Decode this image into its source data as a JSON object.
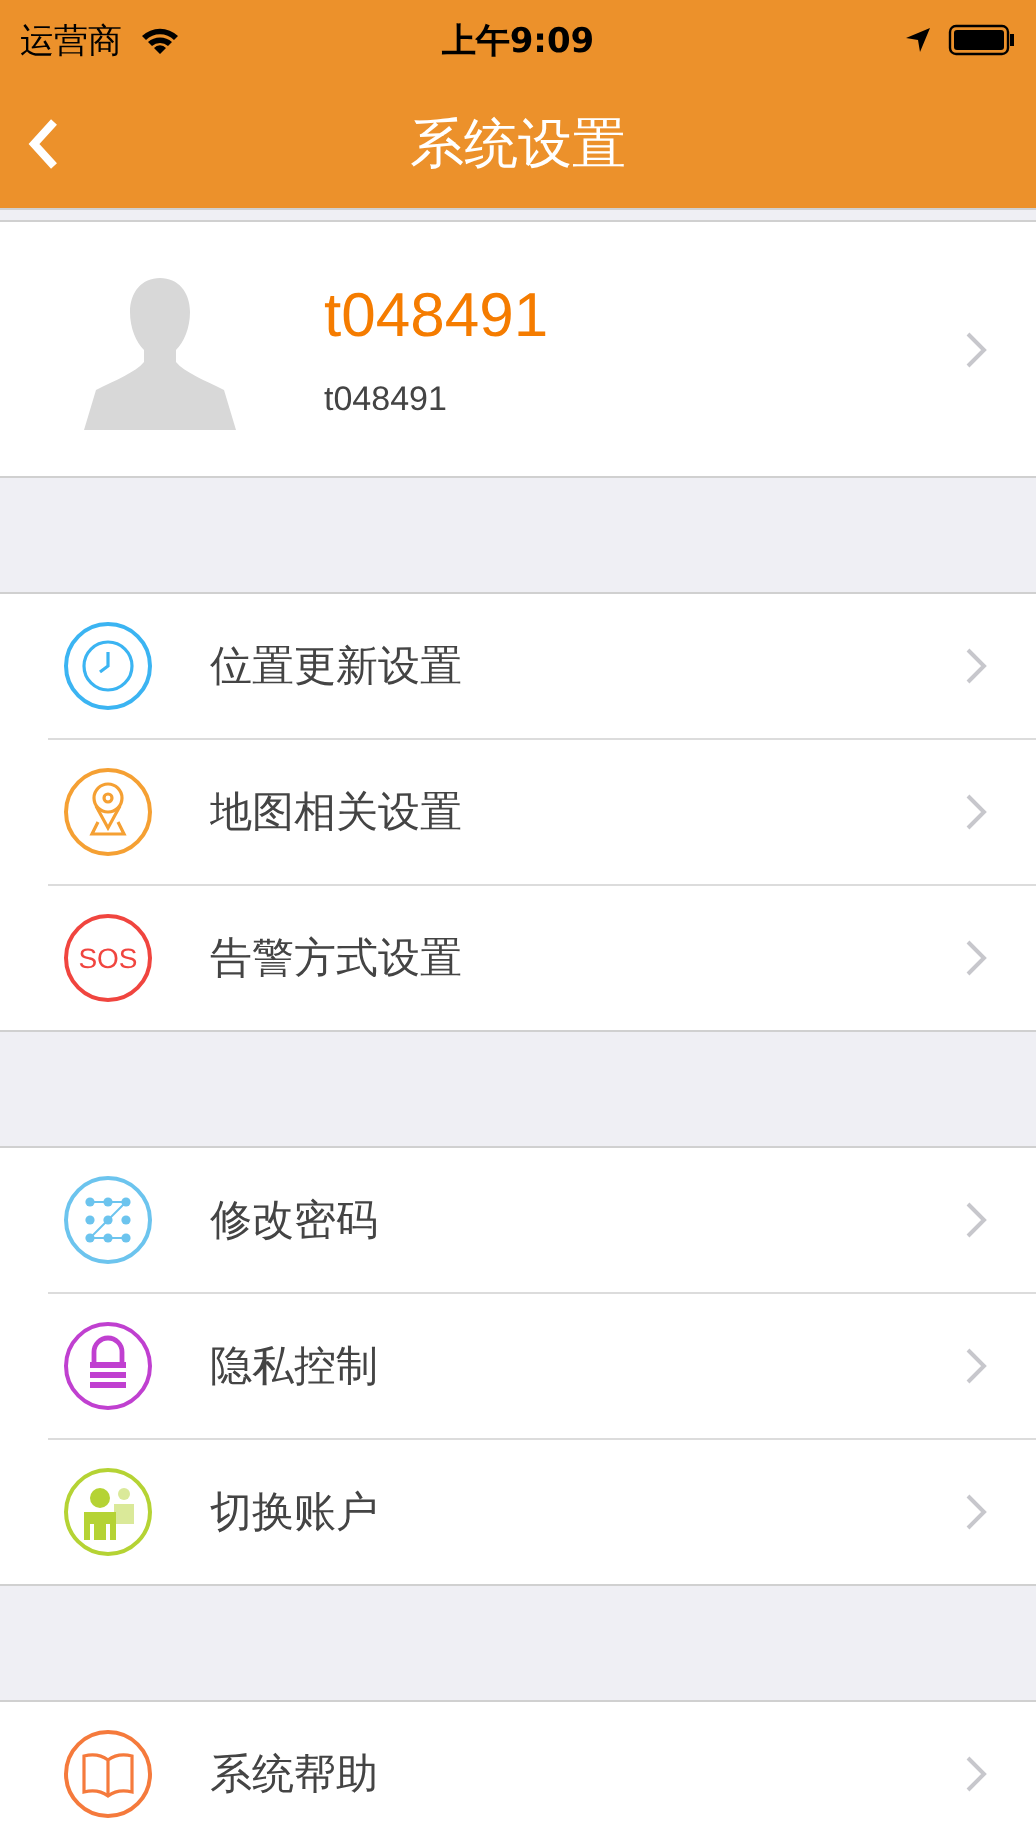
{
  "status_bar": {
    "carrier": "运营商",
    "time": "上午9:09"
  },
  "nav_bar": {
    "title": "系统设置"
  },
  "profile": {
    "name": "t048491",
    "account": "t048491"
  },
  "groups": [
    {
      "items": [
        {
          "kind": "clock",
          "color": "#3bb4f2",
          "label": "位置更新设置"
        },
        {
          "kind": "pin",
          "color": "#f5a033",
          "label": "地图相关设置"
        },
        {
          "kind": "sos",
          "color": "#f0453f",
          "icon_text": "SOS",
          "label": "告警方式设置"
        }
      ]
    },
    {
      "items": [
        {
          "kind": "pattern",
          "color": "#6cc4ee",
          "label": "修改密码"
        },
        {
          "kind": "lock",
          "color": "#c040d0",
          "label": "隐私控制"
        },
        {
          "kind": "users",
          "color": "#b5d334",
          "label": "切换账户"
        }
      ]
    },
    {
      "items": [
        {
          "kind": "book",
          "color": "#f57a3c",
          "label": "系统帮助"
        }
      ]
    }
  ]
}
